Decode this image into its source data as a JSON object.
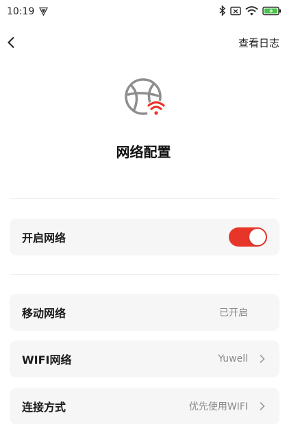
{
  "status_bar": {
    "time": "10:19",
    "icons": [
      "vpn-shield-icon",
      "bluetooth-icon",
      "nfc-icon",
      "wifi-icon",
      "battery-charging-icon"
    ]
  },
  "nav": {
    "back_icon": "chevron-left-icon",
    "log_label": "查看日志"
  },
  "header": {
    "icon": "globe-wifi-icon",
    "title": "网络配置"
  },
  "settings": {
    "network_toggle": {
      "label": "开启网络",
      "enabled": true,
      "color": "#e8352a"
    },
    "mobile_network": {
      "label": "移动网络",
      "value": "已开启"
    },
    "wifi_network": {
      "label": "WIFI网络",
      "value": "Yuwell"
    },
    "connection_mode": {
      "label": "连接方式",
      "value": "优先使用WIFI"
    }
  },
  "colors": {
    "accent": "#e8352a",
    "row_bg": "#f6f6f6",
    "secondary_text": "#8a8a8a"
  }
}
